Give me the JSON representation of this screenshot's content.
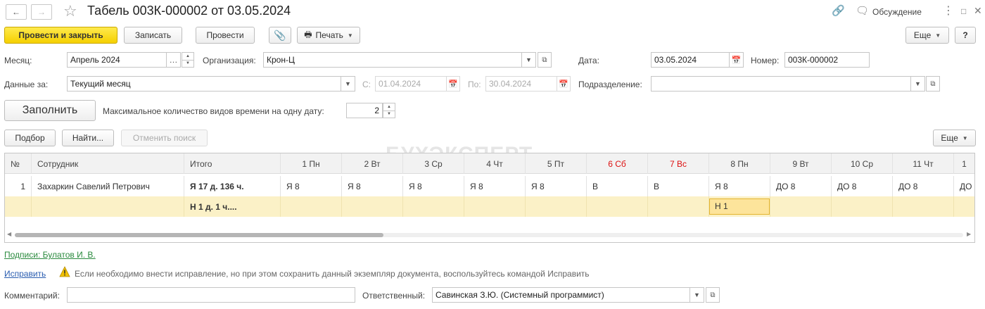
{
  "header": {
    "title": "Табель 003К-000002 от 03.05.2024",
    "discussion_label": "Обсуждение"
  },
  "toolbar": {
    "post_close": "Провести и закрыть",
    "save": "Записать",
    "post": "Провести",
    "print": "Печать",
    "more": "Еще",
    "help": "?"
  },
  "form": {
    "month_label": "Месяц:",
    "month_value": "Апрель 2024",
    "org_label": "Организация:",
    "org_value": "Крон-Ц",
    "date_label": "Дата:",
    "date_value": "03.05.2024",
    "number_label": "Номер:",
    "number_value": "003К-000002",
    "data_for_label": "Данные за:",
    "data_for_value": "Текущий месяц",
    "from_label": "С:",
    "from_value": "01.04.2024",
    "to_label": "По:",
    "to_value": "30.04.2024",
    "division_label": "Подразделение:",
    "division_value": "",
    "fill_button": "Заполнить",
    "max_types_label": "Максимальное количество видов времени на одну дату:",
    "max_types_value": "2"
  },
  "table_toolbar": {
    "pick": "Подбор",
    "find": "Найти...",
    "cancel_search": "Отменить поиск",
    "more": "Еще"
  },
  "table": {
    "columns": {
      "num": "№",
      "employee": "Сотрудник",
      "total": "Итого",
      "days": [
        "1 Пн",
        "2 Вт",
        "3 Ср",
        "4 Чт",
        "5 Пт",
        "6 Сб",
        "7 Вс",
        "8 Пн",
        "9 Вт",
        "10 Ср",
        "11 Чт",
        "1"
      ]
    },
    "row1": {
      "num": "1",
      "employee": "Захаркин Савелий Петрович",
      "total": "Я 17 д. 136 ч.",
      "days": [
        "Я 8",
        "Я 8",
        "Я 8",
        "Я 8",
        "Я 8",
        "В",
        "В",
        "Я 8",
        "ДО 8",
        "ДО 8",
        "ДО 8",
        "ДО"
      ]
    },
    "row2": {
      "total": "Н 1 д. 1 ч....",
      "day8": "Н 1"
    }
  },
  "footer": {
    "signatures_link": "Подписи: Булатов И. В.",
    "fix_link": "Исправить",
    "fix_hint": "Если необходимо внести исправление, но при этом сохранить данный экземпляр документа, воспользуйтесь командой Исправить",
    "comment_label": "Комментарий:",
    "comment_value": "",
    "responsible_label": "Ответственный:",
    "responsible_value": "Савинская З.Ю. (Системный программист)"
  },
  "watermark": "БУХЭКСПЕРТ",
  "colors": {
    "primary_button": "#f5d000",
    "weekend_header": "#d11111",
    "selected_row": "#fbf1c7",
    "link_green": "#2a8a3e",
    "link_blue": "#2a5db0"
  }
}
